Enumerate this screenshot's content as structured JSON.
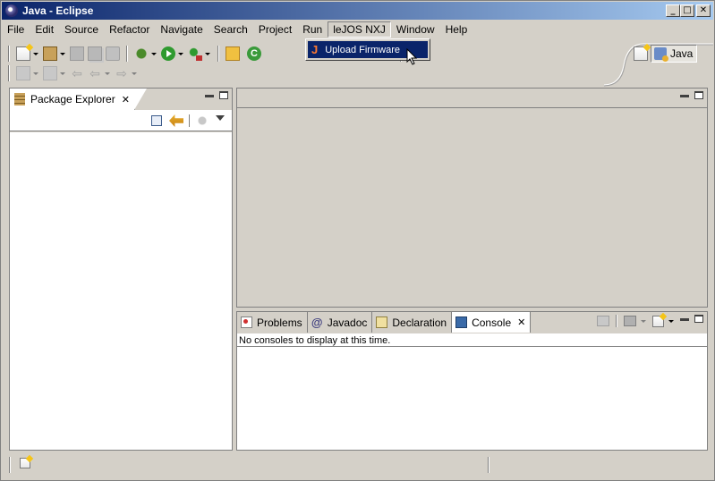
{
  "window": {
    "title": "Java - Eclipse",
    "controls": {
      "minimize": "_",
      "maximize": "□",
      "close": "✕"
    }
  },
  "menubar": {
    "items": [
      "File",
      "Edit",
      "Source",
      "Refactor",
      "Navigate",
      "Search",
      "Project",
      "Run",
      "leJOS NXJ",
      "Window",
      "Help"
    ],
    "open_menu": "leJOS NXJ"
  },
  "dropdown": {
    "items": [
      {
        "label": "Upload Firmware",
        "icon": "lejos-icon",
        "highlighted": true
      }
    ]
  },
  "perspective": {
    "current": "Java"
  },
  "package_explorer": {
    "title": "Package Explorer",
    "close": "✕"
  },
  "console_view": {
    "tabs": [
      {
        "label": "Problems",
        "icon": "problems-icon"
      },
      {
        "label": "Javadoc",
        "icon": "at-icon",
        "glyph": "@"
      },
      {
        "label": "Declaration",
        "icon": "declaration-icon"
      },
      {
        "label": "Console",
        "icon": "console-icon",
        "active": true,
        "close": "✕"
      }
    ],
    "message": "No consoles to display at this time."
  },
  "toolbar": {
    "class_glyph": "C",
    "lejos_glyph": "J",
    "back_glyph": "⇦",
    "forward_glyph": "⇨"
  },
  "colors": {
    "titlebar_start": "#0a246a",
    "titlebar_end": "#a6caf0",
    "menu_highlight": "#0a246a",
    "lejos_accent": "#e05010",
    "chrome": "#d4d0c8"
  }
}
